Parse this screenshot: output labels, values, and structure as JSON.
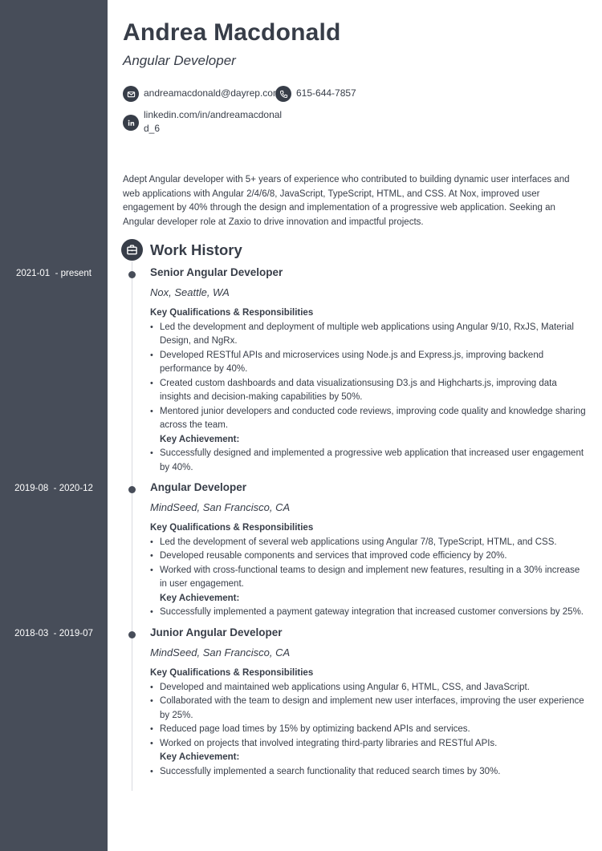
{
  "header": {
    "name": "Andrea Macdonald",
    "title": "Angular Developer"
  },
  "contact": {
    "email": "andreamacdonald@dayrep.com",
    "phone": "615-644-7857",
    "linkedin_line1": "linkedin.com/in/andreamacdonal",
    "linkedin_line2": "d_6"
  },
  "summary": "Adept Angular developer with 5+ years of experience who contributed to building dynamic user interfaces and web applications with Angular 2/4/6/8, JavaScript, TypeScript, HTML, and CSS. At Nox, improved user engagement by 40% through the design and implementation of a progressive web application. Seeking an Angular developer role at Zaxio to drive innovation and impactful projects.",
  "work_history": {
    "section_title": "Work History",
    "qualifications_label": "Key Qualifications & Responsibilities",
    "achievement_label": "Key Achievement:",
    "jobs": [
      {
        "dates": "2021-01  - present",
        "title": "Senior Angular Developer",
        "company": "Nox, Seattle, WA",
        "responsibilities": [
          "Led the development and deployment of multiple web applications using Angular 9/10, RxJS, Material Design, and NgRx.",
          "Developed RESTful APIs and microservices using Node.js and Express.js, improving backend performance by 40%.",
          "Created custom dashboards and data visualizationsusing D3.js and Highcharts.js, improving data insights and decision-making capabilities by 50%.",
          "Mentored junior developers and conducted code reviews, improving code quality and knowledge sharing across the team."
        ],
        "achievements": [
          "Successfully designed and implemented a progressive web application that increased user engagement by 40%."
        ]
      },
      {
        "dates": "2019-08  - 2020-12",
        "title": "Angular Developer",
        "company": "MindSeed, San Francisco, CA",
        "responsibilities": [
          "Led the development of several web applications using Angular 7/8, TypeScript, HTML, and CSS.",
          "Developed reusable components and services that improved code efficiency by 20%.",
          "Worked with cross-functional teams to design and implement new features, resulting in a 30% increase in user engagement."
        ],
        "achievements": [
          "Successfully implemented a payment gateway integration that increased customer conversions by 25%."
        ]
      },
      {
        "dates": "2018-03  - 2019-07",
        "title": "Junior Angular Developer",
        "company": "MindSeed, San Francisco, CA",
        "responsibilities": [
          "Developed and maintained web applications using Angular 6, HTML, CSS, and JavaScript.",
          "Collaborated with the team to design and implement new user interfaces, improving the user experience by 25%.",
          "Reduced page load times by 15% by optimizing backend APIs and services.",
          "Worked on projects that involved integrating third-party libraries and RESTful APIs."
        ],
        "achievements": [
          "Successfully implemented a search functionality that reduced search times by 30%."
        ]
      }
    ]
  }
}
